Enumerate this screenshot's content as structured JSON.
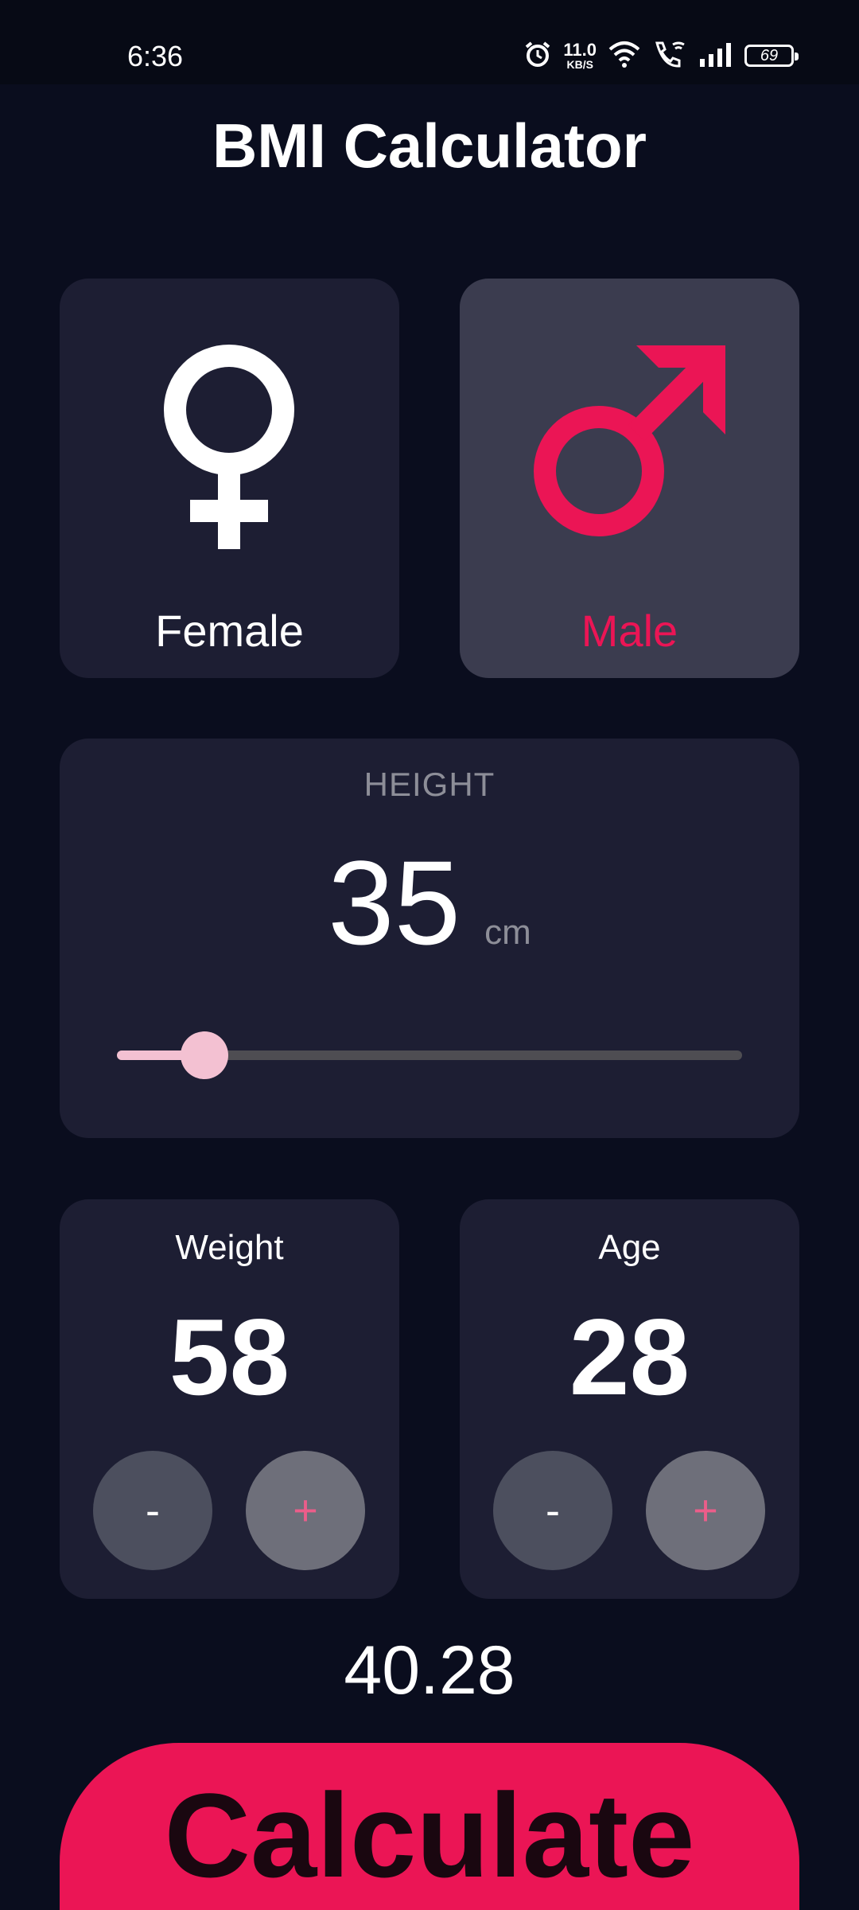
{
  "status_bar": {
    "time": "6:36",
    "net_speed_value": "11.0",
    "net_speed_unit": "KB/S",
    "battery": "69"
  },
  "app": {
    "title": "BMI Calculator"
  },
  "gender": {
    "female_label": "Female",
    "male_label": "Male",
    "selected": "male",
    "inactive_color": "#ffffff",
    "active_color": "#eb1555"
  },
  "height": {
    "title": "HEIGHT",
    "value": "35",
    "unit": "cm",
    "slider_fraction": 0.14
  },
  "weight": {
    "label": "Weight",
    "value": "58",
    "minus_label": "-",
    "plus_label": "+"
  },
  "age": {
    "label": "Age",
    "value": "28",
    "minus_label": "-",
    "plus_label": "+"
  },
  "result": {
    "bmi": "40.28"
  },
  "calculate_button": {
    "label": "Calculate"
  },
  "colors": {
    "background": "#0a0d1e",
    "card": "#1d1e33",
    "card_active": "#3b3c4f",
    "accent": "#eb1555",
    "slider": "#f3c1d2"
  }
}
